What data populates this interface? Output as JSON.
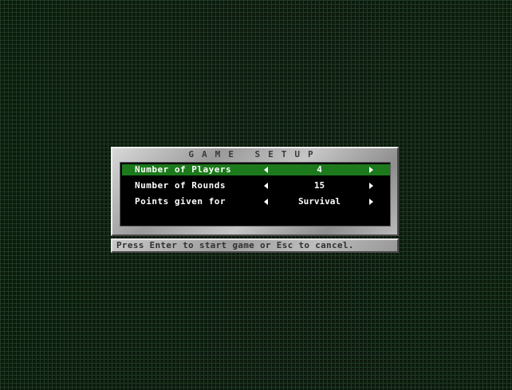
{
  "dialog": {
    "title": "GAME SETUP",
    "options": [
      {
        "label": "Number of Players",
        "value": "4",
        "selected": true
      },
      {
        "label": "Number of Rounds",
        "value": "15",
        "selected": false
      },
      {
        "label": "Points given for",
        "value": "Survival",
        "selected": false
      }
    ]
  },
  "status": {
    "text": "Press Enter to start game or Esc to cancel."
  },
  "colors": {
    "background": "#0c1a0e",
    "grid": "#1f3a22",
    "selection": "#1c7a1c",
    "panel": "#000000",
    "text": "#ffffff"
  },
  "icons": [
    "left-arrow-icon",
    "right-arrow-icon"
  ]
}
